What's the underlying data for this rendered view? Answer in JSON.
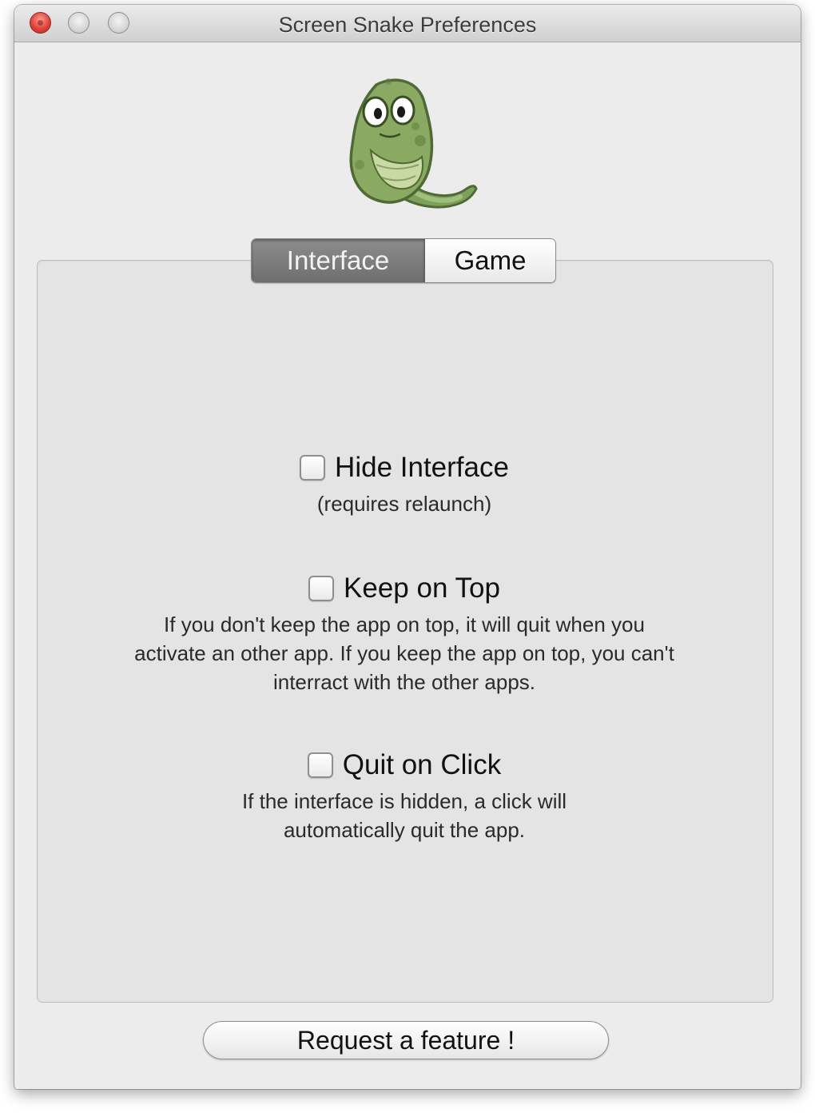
{
  "window": {
    "title": "Screen Snake Preferences"
  },
  "tabs": [
    {
      "label": "Interface",
      "selected": true
    },
    {
      "label": "Game",
      "selected": false
    }
  ],
  "options": [
    {
      "label": "Hide Interface",
      "checked": false,
      "description": "(requires relaunch)"
    },
    {
      "label": "Keep on Top",
      "checked": false,
      "description_lines": [
        "If you don't keep the app on top, it will quit when you",
        "activate an other app. If you keep the app on top, you can't",
        "interract with the other apps."
      ]
    },
    {
      "label": "Quit on Click",
      "checked": false,
      "description_lines": [
        "If the interface is hidden, a click will",
        "automatically quit the app."
      ]
    }
  ],
  "button": {
    "label": "Request a feature !"
  },
  "icons": {
    "mascot": "snake-mascot-icon"
  },
  "colors": {
    "close_light": "#e0443a",
    "selected_tab": "#7d7d7d",
    "snake_green": "#7fa05c"
  }
}
